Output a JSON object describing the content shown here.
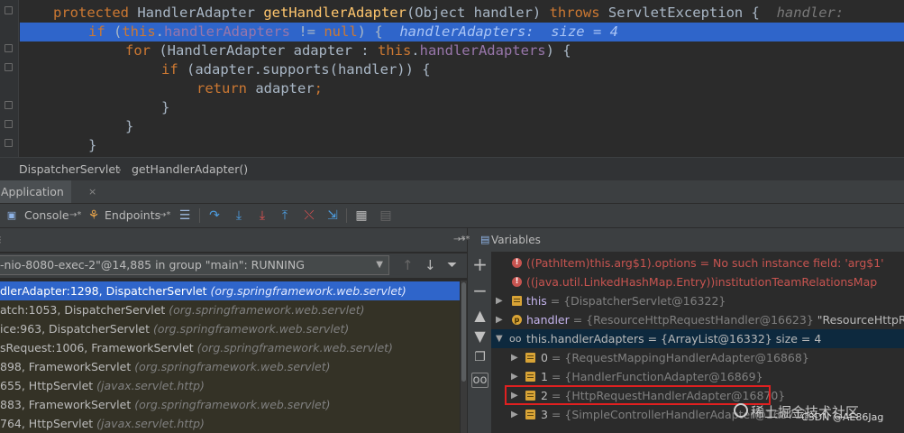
{
  "editor": {
    "lines": [
      {
        "kw": "protected ",
        "type": "HandlerAdapter ",
        "fn": "getHandlerAdapter",
        "rest": "(Object handler) ",
        "kw2": "throws ",
        "rest2": "ServletException {  ",
        "hint": "handler: "
      },
      {
        "kw": "if ",
        "p1": "(",
        "kw_this": "this",
        ".": ".",
        "fld": "handlerAdapters",
        "rest": " != ",
        "kw_null": "null",
        ") {": ") {  ",
        "hint": "handlerAdapters:  size = 4"
      },
      {
        "kw": "for ",
        "rest": "(HandlerAdapter adapter : ",
        "kw_this": "this",
        ".": ".",
        "fld": "handlerAdapters",
        ") {": ") {"
      },
      {
        "kw": "if ",
        "rest": "(adapter.supports(handler)) {"
      },
      {
        "kw": "return ",
        "rest": "adapter",
        ";": ";"
      },
      {
        "rest": "}"
      },
      {
        "rest": "}"
      },
      {
        "rest": "}"
      }
    ]
  },
  "breadcrumb": {
    "class": "DispatcherServlet",
    "method": "getHandlerAdapter()"
  },
  "debug_tab": {
    "label": "Application",
    "close": "×"
  },
  "toolbar": {
    "console": "Console",
    "console_pin": "→*",
    "endpoints": "Endpoints",
    "endpoints_pin": "→*"
  },
  "frames": {
    "header_pin": "→*",
    "thread": "-nio-8080-exec-2\"@14,885 in group \"main\": RUNNING",
    "items": [
      {
        "m": "dlerAdapter:1298, DispatcherServlet ",
        "pkg": "(org.springframework.web.servlet)"
      },
      {
        "m": "atch:1053, DispatcherServlet ",
        "pkg": "(org.springframework.web.servlet)"
      },
      {
        "m": "ice:963, DispatcherServlet ",
        "pkg": "(org.springframework.web.servlet)"
      },
      {
        "m": "sRequest:1006, FrameworkServlet ",
        "pkg": "(org.springframework.web.servlet)"
      },
      {
        "m": "898, FrameworkServlet ",
        "pkg": "(org.springframework.web.servlet)"
      },
      {
        "m": "655, HttpServlet ",
        "pkg": "(javax.servlet.http)"
      },
      {
        "m": "883, FrameworkServlet ",
        "pkg": "(org.springframework.web.servlet)"
      },
      {
        "m": "764, HttpServlet ",
        "pkg": "(javax.servlet.http)"
      }
    ]
  },
  "variables": {
    "title": "Variables",
    "header_pin": "→*",
    "rows": [
      {
        "text": "((PathItem)this.arg$1).options = No such instance field: 'arg$1'"
      },
      {
        "text": "((java.util.LinkedHashMap.Entry))institutionTeamRelationsMap"
      },
      {
        "name": "this",
        "value": " = {DispatcherServlet@16322}"
      },
      {
        "name": "handler",
        "value": " = {ResourceHttpRequestHandler@16623} ",
        "extra": "\"ResourceHttpReques"
      },
      {
        "name": "this.handlerAdapters",
        "value": " = {ArrayList@16332}  size = 4"
      },
      {
        "name": "0",
        "value": " = {RequestMappingHandlerAdapter@16868}"
      },
      {
        "name": "1",
        "value": " = {HandlerFunctionAdapter@16869}"
      },
      {
        "name": "2",
        "value": " = {HttpRequestHandlerAdapter@16870}"
      },
      {
        "name": "3",
        "value": " = {SimpleControllerHandlerAdapter@16871}"
      }
    ]
  },
  "watermark": {
    "text": "稀土掘金技术社区",
    "csdn": "CSDN @AE86Jag"
  },
  "colors": {
    "accent": "#2f65ca",
    "keyword": "#cc7832",
    "method": "#ffc66d",
    "field": "#9876aa",
    "error": "#c75450",
    "highlight_box": "#e02020"
  }
}
